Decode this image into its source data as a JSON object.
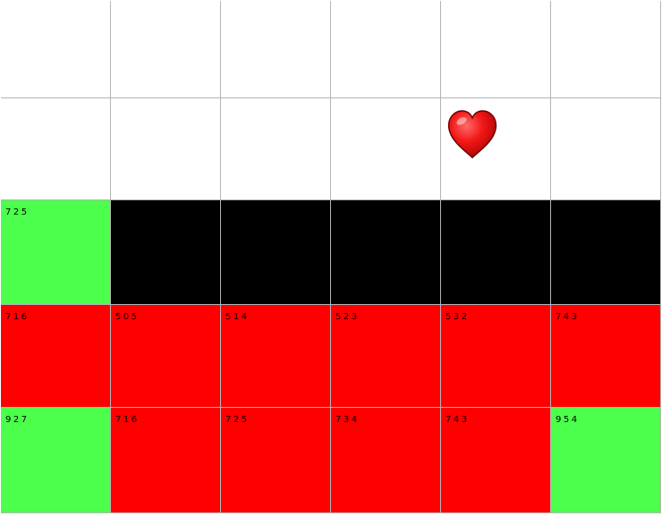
{
  "colors": {
    "white": "#ffffff",
    "black": "#000000",
    "red": "#ff0000",
    "green": "#4cff4c"
  },
  "board": {
    "rows": [
      [
        {
          "color": "white",
          "value": ""
        },
        {
          "color": "white",
          "value": ""
        },
        {
          "color": "white",
          "value": ""
        },
        {
          "color": "white",
          "value": ""
        },
        {
          "color": "white",
          "value": ""
        },
        {
          "color": "white",
          "value": ""
        }
      ],
      [
        {
          "color": "white",
          "value": ""
        },
        {
          "color": "white",
          "value": ""
        },
        {
          "color": "white",
          "value": ""
        },
        {
          "color": "white",
          "value": ""
        },
        {
          "color": "white",
          "value": "",
          "icon": "heart-icon"
        },
        {
          "color": "white",
          "value": ""
        }
      ],
      [
        {
          "color": "green",
          "value": "725"
        },
        {
          "color": "black",
          "value": ""
        },
        {
          "color": "black",
          "value": ""
        },
        {
          "color": "black",
          "value": ""
        },
        {
          "color": "black",
          "value": ""
        },
        {
          "color": "black",
          "value": ""
        }
      ],
      [
        {
          "color": "red",
          "value": "716"
        },
        {
          "color": "red",
          "value": "505"
        },
        {
          "color": "red",
          "value": "514"
        },
        {
          "color": "red",
          "value": "523"
        },
        {
          "color": "red",
          "value": "532"
        },
        {
          "color": "red",
          "value": "743"
        }
      ],
      [
        {
          "color": "green",
          "value": "927"
        },
        {
          "color": "red",
          "value": "716"
        },
        {
          "color": "red",
          "value": "725"
        },
        {
          "color": "red",
          "value": "734"
        },
        {
          "color": "red",
          "value": "743"
        },
        {
          "color": "green",
          "value": "954"
        }
      ]
    ]
  }
}
